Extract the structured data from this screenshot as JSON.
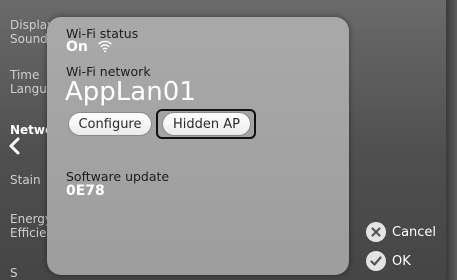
{
  "menu": {
    "items": [
      {
        "label": "Display"
      },
      {
        "label": "Sound"
      },
      {
        "label": "Time"
      },
      {
        "label": "Language"
      },
      {
        "label": "Network"
      },
      {
        "label": "Stain"
      },
      {
        "label": "Energy"
      },
      {
        "label": "Efficiency"
      },
      {
        "label": "S"
      }
    ]
  },
  "dialog": {
    "wifi_status_label": "Wi-Fi status",
    "wifi_status_value": "On",
    "wifi_network_label": "Wi-Fi network",
    "wifi_network_value": "AppLan01",
    "configure_button": "Configure",
    "hidden_ap_button": "Hidden AP",
    "software_update_label": "Software update",
    "software_update_value": "0E78"
  },
  "actions": {
    "cancel_label": "Cancel",
    "ok_label": "OK"
  },
  "icons": {
    "wifi": "wifi-icon",
    "back": "chevron-left-icon",
    "cancel": "close-icon",
    "ok": "check-icon"
  },
  "colors": {
    "popup_bg": "#a9a9a9",
    "focus_border": "#111111",
    "text_white": "#ffffff"
  }
}
